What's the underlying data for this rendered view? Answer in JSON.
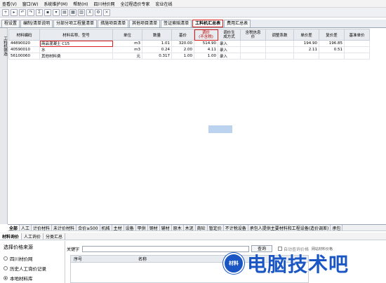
{
  "menu": [
    "查看(V)",
    "窗口(W)",
    "系统维护(M)",
    "帮助(H)",
    "四川材价网",
    "全过程造价专家",
    "宏业在线"
  ],
  "toolbar_icons": [
    "new-icon",
    "open-icon",
    "undo-icon",
    "redo-icon",
    "calc-icon",
    "save-icon",
    "filter-icon",
    "print-icon",
    "layout-icon",
    "grid-icon",
    "excel-icon",
    "settings-icon",
    "close-icon"
  ],
  "tabs": [
    {
      "label": "程设置",
      "active": false
    },
    {
      "label": "编制/清单说明",
      "active": false
    },
    {
      "label": "分部分项工程量清单",
      "active": false
    },
    {
      "label": "措施项目清单",
      "active": false
    },
    {
      "label": "其他项目清单",
      "active": false
    },
    {
      "label": "签证索赔清单",
      "active": false
    },
    {
      "label": "工料机汇总表",
      "active": true
    },
    {
      "label": "费用汇总表",
      "active": false
    }
  ],
  "sidebar_label": "工料机筛选",
  "columns": [
    "材料编码",
    "材料名称、型号",
    "单位",
    "数量",
    "基价",
    "调价\n(不含税)",
    "调价生\n成方式",
    "含税信息\n价",
    "调整系数",
    "单价差",
    "复价差",
    "基准单价"
  ],
  "rows": [
    {
      "code": "44890020",
      "name": "商品混凝土 C15",
      "unit": "m3",
      "qty": "1.01",
      "base": "320.00",
      "adj": "514.90",
      "method": "录入",
      "tax": "",
      "coef": "",
      "diff": "194.90",
      "rediff": "196.85",
      "std": ""
    },
    {
      "code": "40590010",
      "name": "水",
      "unit": "m3",
      "qty": "0.24",
      "base": "2.00",
      "adj": "4.11",
      "method": "录入",
      "tax": "",
      "coef": "",
      "diff": "2.11",
      "rediff": "0.51",
      "std": ""
    },
    {
      "code": "56100060",
      "name": "其他材料费",
      "unit": "元",
      "qty": "0.317",
      "base": "1.00",
      "adj": "1.00",
      "method": "录入",
      "tax": "",
      "coef": "",
      "diff": "",
      "rediff": "",
      "std": ""
    }
  ],
  "bottom_tabs": [
    "全部",
    "人工",
    "计价材料",
    "未计价材料",
    "合价≥500",
    "机械",
    "主材",
    "设备",
    "甲供",
    "钢材",
    "辅材",
    "原木",
    "木泥",
    "商砼",
    "暂定价",
    "不计税设备",
    "承包人提供主要材料和工程设备(造价调差)",
    "承包"
  ],
  "lower_tabs": [
    "材料询价",
    "人工询价",
    "分类汇总"
  ],
  "price_source": {
    "title": "选择价格来源",
    "options": [
      {
        "label": "四川材价网",
        "selected": false
      },
      {
        "label": "历史人工询价记录",
        "selected": false
      },
      {
        "label": "本地材料库",
        "selected": true
      }
    ]
  },
  "search": {
    "label": "关键字",
    "value": "",
    "button": "查询",
    "checkbox_label": "自动查询价格",
    "extra": "网站材料价格"
  },
  "lower_grid": {
    "columns": [
      "序号",
      "名称"
    ]
  },
  "watermark": {
    "logo_text": "材料",
    "text": "电脑技术吧"
  }
}
